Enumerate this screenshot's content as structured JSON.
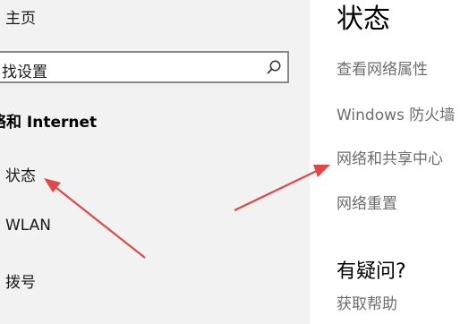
{
  "sidebar": {
    "home_label": "主页",
    "search": {
      "value": "找设置"
    },
    "section_heading": "络和 Internet",
    "items": [
      {
        "label": "状态"
      },
      {
        "label": "WLAN"
      },
      {
        "label": "拨号"
      }
    ]
  },
  "main": {
    "title": "状态",
    "links": [
      {
        "label": "查看网络属性"
      },
      {
        "label": "Windows 防火墙"
      },
      {
        "label": "网络和共享中心"
      },
      {
        "label": "网络重置"
      }
    ],
    "help_heading": "有疑问?",
    "help_link": "获取帮助"
  },
  "annotations": {
    "arrow_color": "#e04848"
  },
  "icons": {
    "search": "search-icon"
  }
}
